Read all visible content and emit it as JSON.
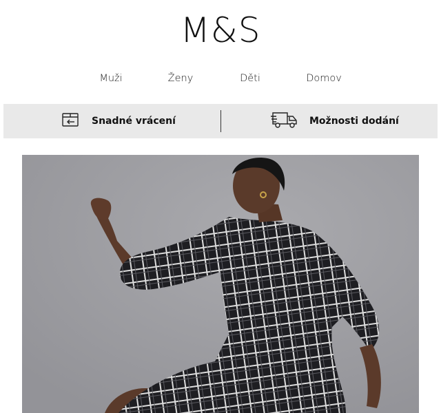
{
  "brand": {
    "logo_text": "M&S"
  },
  "nav": {
    "items": [
      {
        "label": "Muži"
      },
      {
        "label": "Ženy"
      },
      {
        "label": "Děti"
      },
      {
        "label": "Domov"
      }
    ]
  },
  "benefits": {
    "returns": {
      "label": "Snadné vrácení",
      "icon": "return-box-icon"
    },
    "delivery": {
      "label": "Možnosti dodání",
      "icon": "delivery-truck-icon"
    }
  },
  "hero": {
    "image": "woman-in-checked-dress-photo",
    "colors": {
      "background": "#a0a0a4",
      "dress": "#1e1e22",
      "check": "#e6e6e6"
    }
  }
}
